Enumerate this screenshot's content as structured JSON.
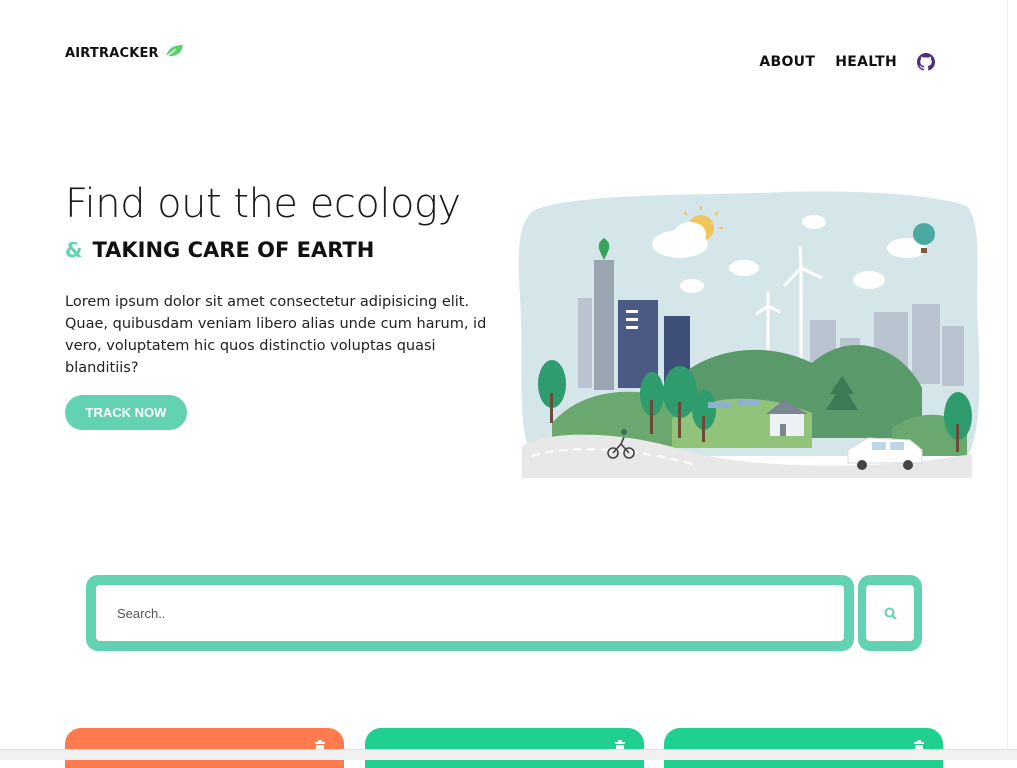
{
  "header": {
    "brand": "AIRTRACKER",
    "nav": {
      "about": "ABOUT",
      "health": "HEALTH"
    }
  },
  "hero": {
    "title": "Find out the ecology",
    "sub_amp": "&",
    "sub_text": "TAKING CARE OF EARTH",
    "body": "Lorem ipsum dolor sit amet consectetur adipisicing elit. Quae, quibusdam veniam libero alias unde cum harum, id vero, voluptatem hic quos distinctio voluptas quasi blanditiis?",
    "cta": "TRACK NOW"
  },
  "search": {
    "placeholder": "Search..",
    "value": ""
  },
  "cards": [
    {
      "color": "#ff7a4f",
      "icon": "trash-icon"
    },
    {
      "color": "#20d08f",
      "icon": "trash-icon"
    },
    {
      "color": "#20d08f",
      "icon": "trash-icon"
    }
  ],
  "colors": {
    "accent": "#62d2b3",
    "brand_leaf": "#5bd06f",
    "github": "#4b2d83"
  }
}
